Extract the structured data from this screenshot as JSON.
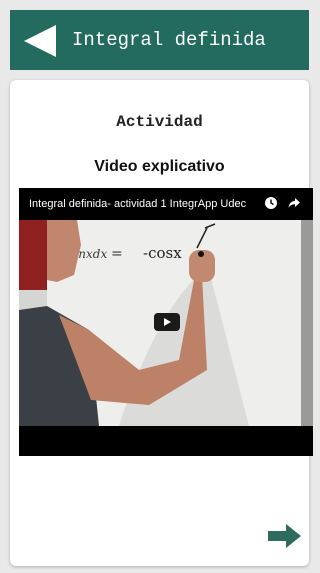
{
  "header": {
    "title": "Integral definida",
    "back_icon": "back-arrow-icon"
  },
  "card": {
    "activity_title": "Actividad",
    "video_heading": "Video explicativo"
  },
  "video": {
    "title": "Integral definida- actividad 1 IntegrApp Udec",
    "board_text_left": "senxdx",
    "board_equals": "=",
    "board_text_right": "-cosx",
    "icons": [
      "clock-icon",
      "share-icon",
      "play-icon"
    ]
  },
  "footer": {
    "next_icon": "forward-arrow-icon"
  },
  "colors": {
    "header_bg": "#236b5f",
    "page_bg": "#e9e9e9",
    "card_bg": "#ffffff",
    "next_arrow": "#2e6b5c"
  }
}
